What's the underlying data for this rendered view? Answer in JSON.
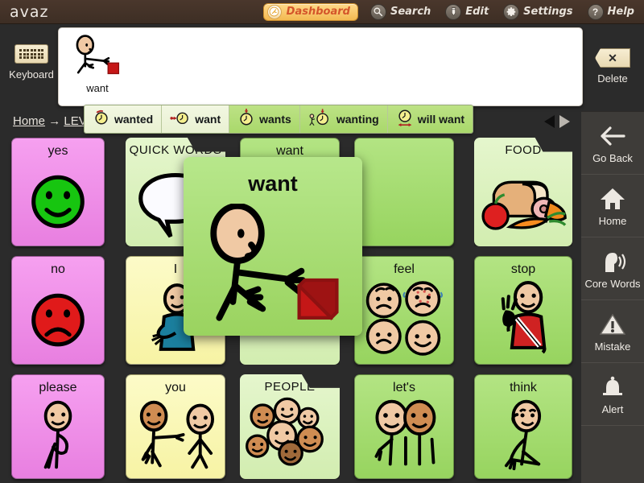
{
  "app": {
    "logo": "avaz",
    "background_color": "#2b2b2b",
    "topbar_color": "#3d2e24"
  },
  "topbar": {
    "dashboard": {
      "label": "Dashboard",
      "icon": "dashboard-gauge-icon",
      "accent": "#d4552a",
      "bg": "#f3b951"
    },
    "items": [
      {
        "label": "Search",
        "icon": "search-icon",
        "glyph": "⌕"
      },
      {
        "label": "Edit",
        "icon": "pencil-icon",
        "glyph": "✎"
      },
      {
        "label": "Settings",
        "icon": "gear-icon",
        "glyph": "⚙"
      },
      {
        "label": "Help",
        "icon": "question-mark-icon",
        "glyph": "?"
      }
    ]
  },
  "keyboard_button": {
    "label": "Keyboard",
    "icon": "keyboard-icon"
  },
  "delete_button": {
    "label": "Delete",
    "icon": "delete-x-icon",
    "glyph": "✕"
  },
  "sentence_bar": {
    "items": [
      {
        "label": "want",
        "art": "person-reaching-for-red-cube"
      }
    ]
  },
  "tense_bar": {
    "options": [
      {
        "label": "wanted",
        "icon": "clock-past-icon",
        "state": "pale"
      },
      {
        "label": "want",
        "icon": "clock-present-icon",
        "state": "pale"
      },
      {
        "label": "wants",
        "icon": "clock-third-person-icon",
        "state": "bright"
      },
      {
        "label": "wanting",
        "icon": "clock-progressive-icon",
        "state": "bright"
      },
      {
        "label": "will want",
        "icon": "clock-future-icon",
        "state": "bright"
      }
    ]
  },
  "breadcrumb": {
    "home": "Home",
    "separator": "→",
    "current": "LEV"
  },
  "pager": {
    "prev_icon": "triangle-left-icon",
    "next_icon": "triangle-right-icon",
    "prev_enabled": true,
    "next_enabled": false
  },
  "grid": {
    "cells": [
      {
        "label": "yes",
        "color": "pink",
        "type": "word",
        "art": "green-smiley-face"
      },
      {
        "label": "QUICK WORDS",
        "color": "foldergreen",
        "type": "folder",
        "art": "speech-bubble"
      },
      {
        "label": "want",
        "color": "green",
        "type": "word",
        "art": "person-reaching-for-red-cube"
      },
      {
        "label": "",
        "color": "green",
        "type": "word",
        "art": "hidden-behind-popup"
      },
      {
        "label": "FOOD",
        "color": "foldergreen",
        "type": "folder",
        "art": "bread-ham-apple-carrot"
      },
      {
        "label": "no",
        "color": "pink",
        "type": "word",
        "art": "red-sad-face"
      },
      {
        "label": "I",
        "color": "yellow",
        "type": "word",
        "art": "person-pointing-at-self"
      },
      {
        "label": "",
        "color": "foldergreen",
        "type": "folder",
        "art": "hidden-behind-popup"
      },
      {
        "label": "feel",
        "color": "green",
        "type": "word",
        "art": "four-emotion-faces"
      },
      {
        "label": "stop",
        "color": "green",
        "type": "word",
        "art": "person-raising-hand-red-shirt"
      },
      {
        "label": "please",
        "color": "pink",
        "type": "word",
        "art": "person-gesturing-please"
      },
      {
        "label": "you",
        "color": "yellow",
        "type": "word",
        "art": "person-pointing-at-other"
      },
      {
        "label": "PEOPLE",
        "color": "foldergreen",
        "type": "folder",
        "art": "group-of-faces"
      },
      {
        "label": "let's",
        "color": "green",
        "type": "word",
        "art": "two-people-together"
      },
      {
        "label": "think",
        "color": "green",
        "type": "word",
        "art": "person-hand-to-chin"
      }
    ]
  },
  "popup": {
    "label": "want",
    "art": "person-reaching-for-red-cube",
    "color": "#9ad35f"
  },
  "rail": {
    "items": [
      {
        "label": "Go Back",
        "icon": "arrow-left-icon"
      },
      {
        "label": "Home",
        "icon": "home-icon"
      },
      {
        "label": "Core Words",
        "icon": "head-speaking-icon"
      },
      {
        "label": "Mistake",
        "icon": "warning-triangle-icon"
      },
      {
        "label": "Alert",
        "icon": "bell-icon"
      }
    ]
  }
}
